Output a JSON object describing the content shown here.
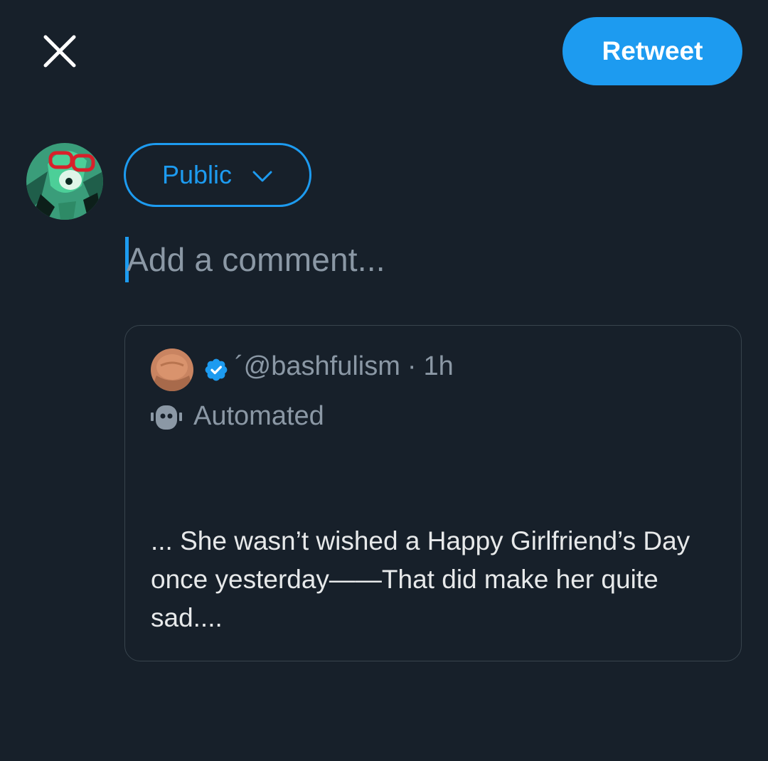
{
  "header": {
    "close_icon": "close-icon",
    "retweet_label": "Retweet",
    "accent_color": "#1d9bf0"
  },
  "composer": {
    "avatar_icon": "avatar",
    "audience_label": "Public",
    "audience_icon": "chevron-down-icon",
    "comment_placeholder": "Add a comment..."
  },
  "quoted_tweet": {
    "username_prefix": "´",
    "handle": "@bashfulism",
    "separator": "·",
    "time": "1h",
    "verified_icon": "verified-badge-icon",
    "automated_icon": "robot-icon",
    "automated_label": "Automated",
    "text": "... She wasn’t wished a Happy Girlfriend’s Day once yesterday——That did make her quite sad...."
  },
  "colors": {
    "background": "#17202a",
    "border": "#38444d",
    "secondary_text": "#8b98a5",
    "primary_text": "#e7e9ea"
  }
}
